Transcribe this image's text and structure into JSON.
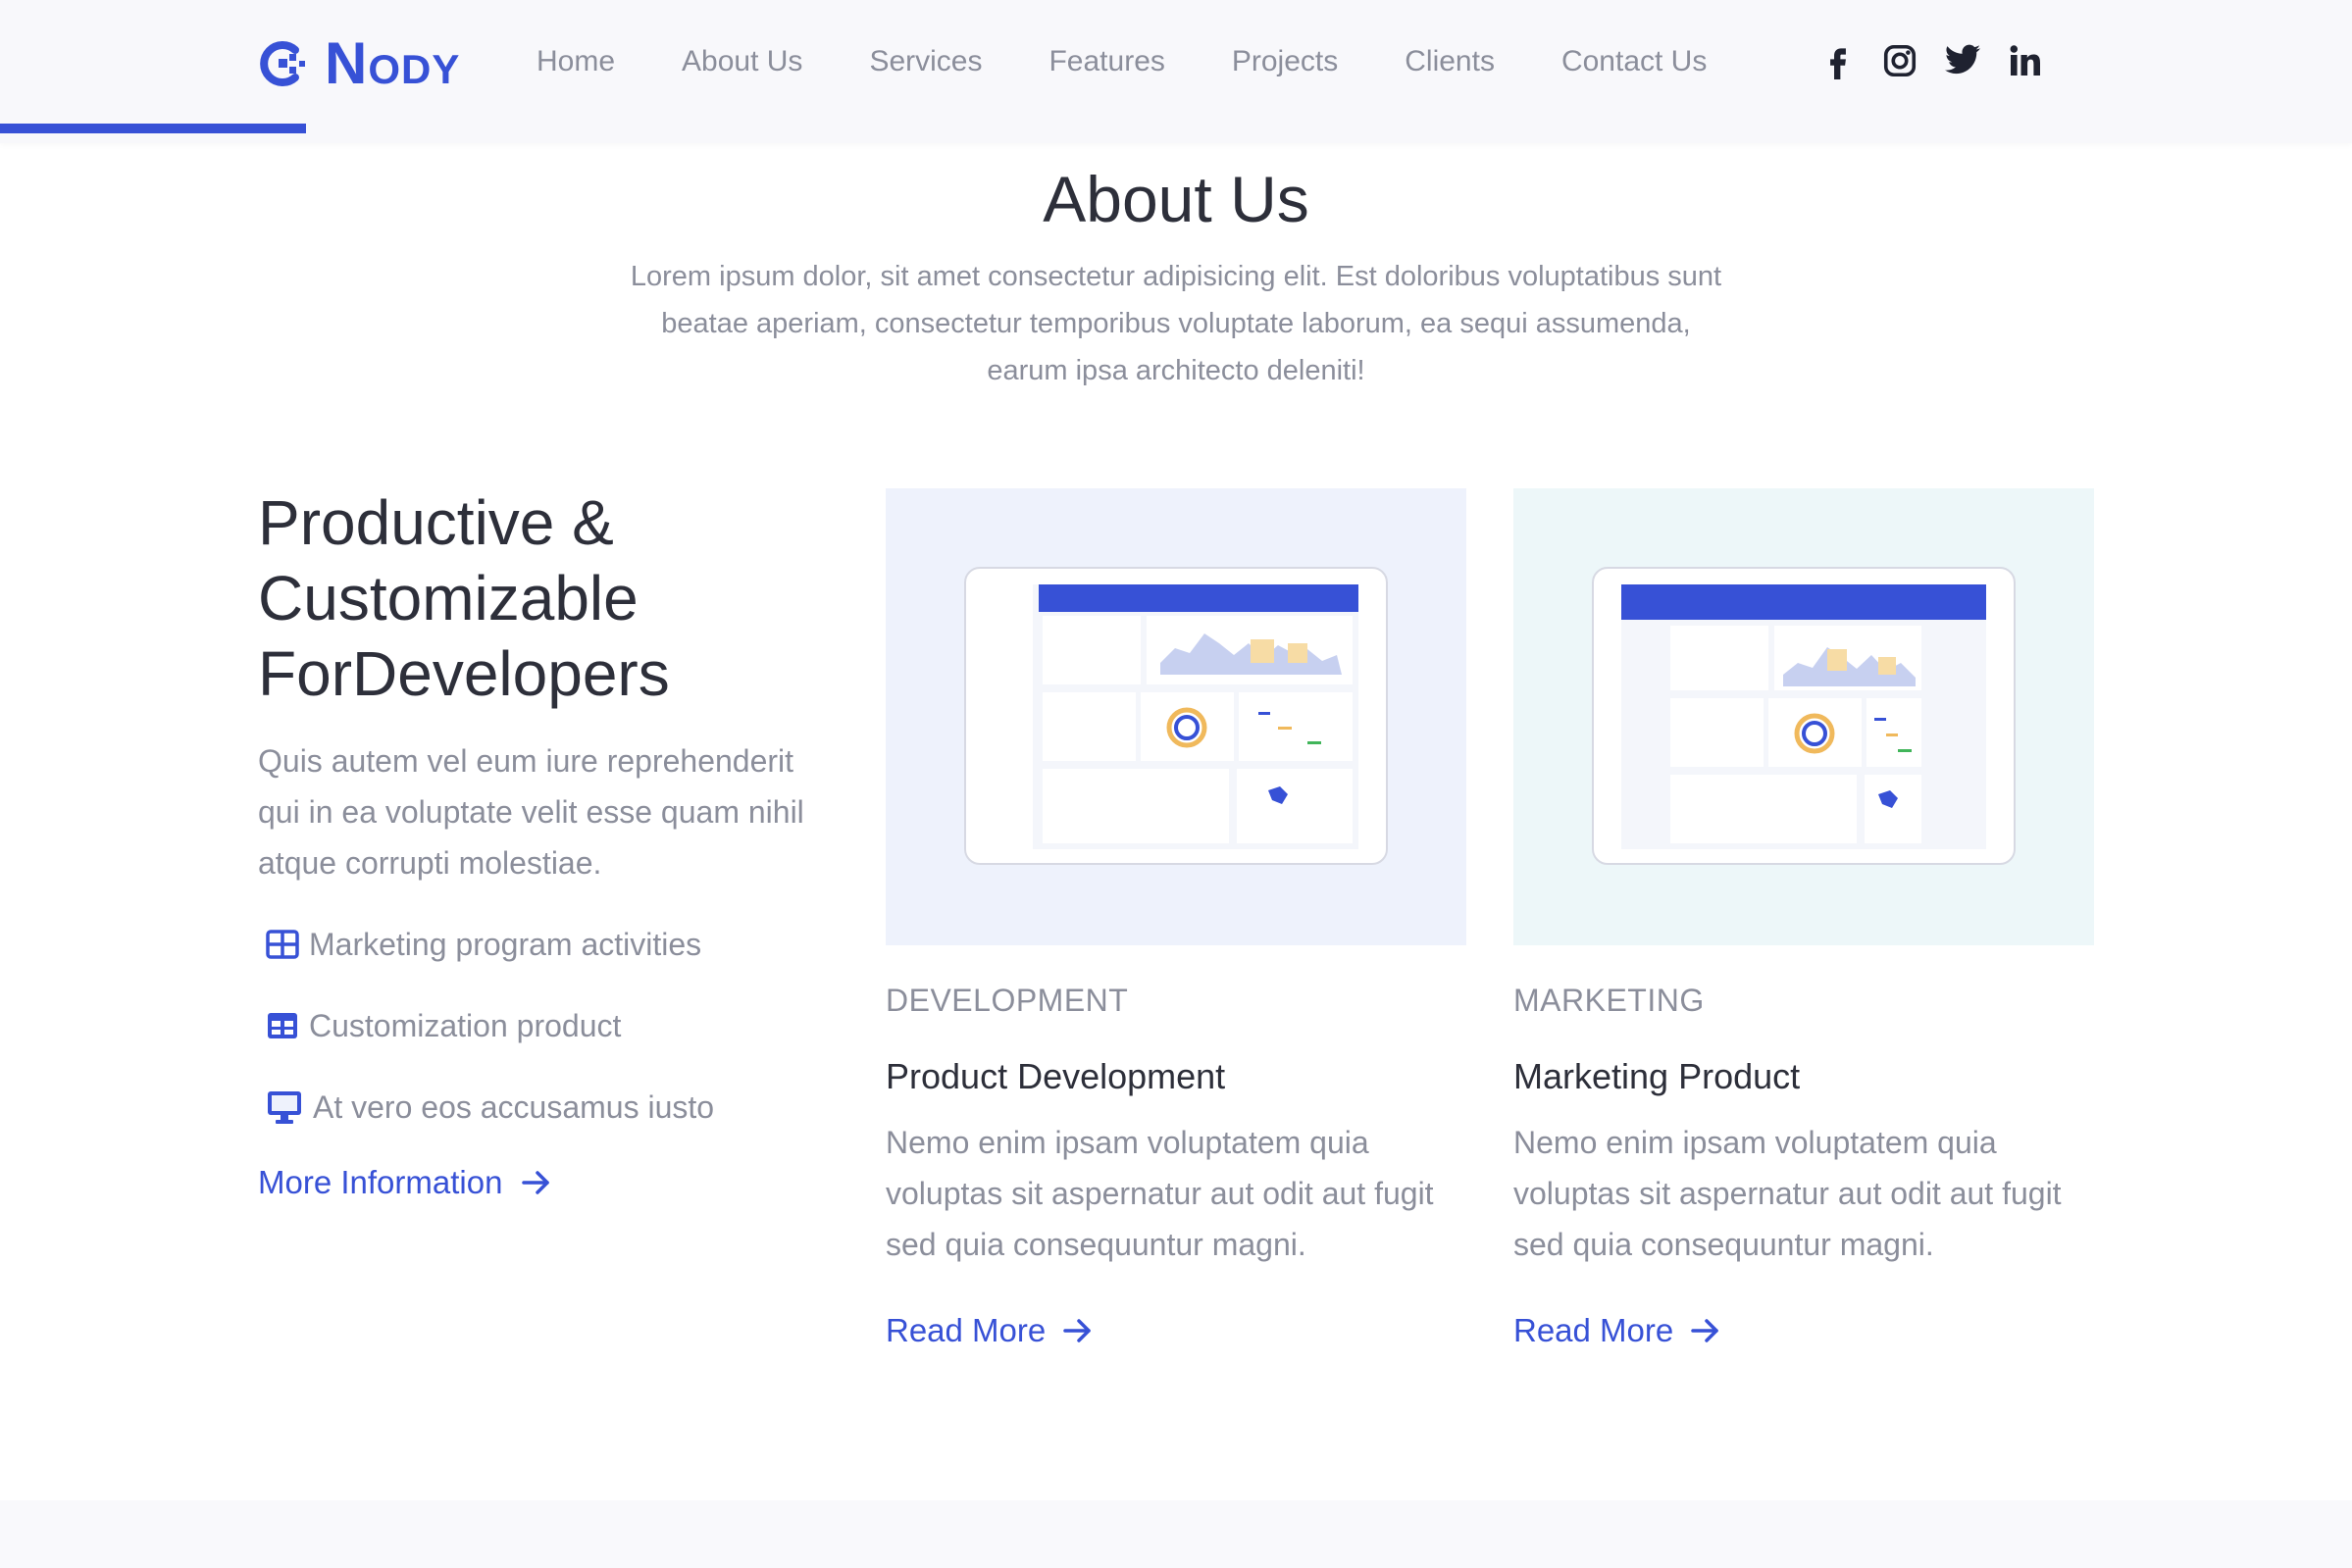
{
  "brand": {
    "name": "Nody",
    "accent": "#3751d6"
  },
  "scroll_progress_percent": 13,
  "nav": {
    "items": [
      "Home",
      "About Us",
      "Services",
      "Features",
      "Projects",
      "Clients",
      "Contact Us"
    ]
  },
  "social": [
    "facebook-icon",
    "instagram-icon",
    "twitter-icon",
    "linkedin-icon"
  ],
  "about": {
    "title": "About Us",
    "description": "Lorem ipsum dolor, sit amet consectetur adipisicing elit. Est doloribus voluptatibus sunt beatae aperiam, consectetur temporibus voluptate laborum, ea sequi assumenda, earum ipsa architecto deleniti!"
  },
  "intro": {
    "title": "Productive & Customizable ForDevelopers",
    "description": "Quis autem vel eum iure reprehenderit qui in ea voluptate velit esse quam nihil atque corrupti molestiae.",
    "features": [
      {
        "icon": "grid-icon",
        "label": "Marketing program activities"
      },
      {
        "icon": "table-icon",
        "label": "Customization product"
      },
      {
        "icon": "monitor-icon",
        "label": "At vero eos accusamus iusto"
      }
    ],
    "more_link": "More Information"
  },
  "cards": [
    {
      "category": "DEVELOPMENT",
      "title": "Product Development",
      "text": "Nemo enim ipsam voluptatem quia voluptas sit aspernatur aut odit aut fugit sed quia consequuntur magni.",
      "link": "Read More",
      "bg": "#eef2fc"
    },
    {
      "category": "MARKETING",
      "title": "Marketing Product",
      "text": "Nemo enim ipsam voluptatem quia voluptas sit aspernatur aut odit aut fugit sed quia consequuntur magni.",
      "link": "Read More",
      "bg": "#edf7f9"
    }
  ]
}
